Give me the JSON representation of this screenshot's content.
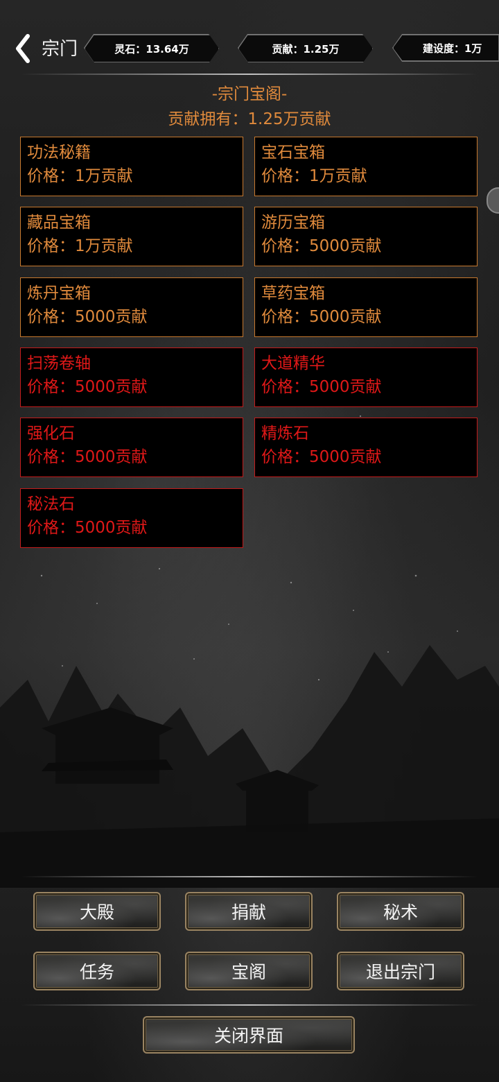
{
  "header": {
    "title": "宗门",
    "stats": [
      {
        "label": "灵石：13.64万"
      },
      {
        "label": "贡献：1.25万"
      },
      {
        "label": "建设度：1万"
      }
    ]
  },
  "shop": {
    "title": "-宗门宝阁-",
    "owned": "贡献拥有：1.25万贡献",
    "items": [
      {
        "name": "功法秘籍",
        "price": "价格：1万贡献",
        "affordable": true
      },
      {
        "name": "宝石宝箱",
        "price": "价格：1万贡献",
        "affordable": true
      },
      {
        "name": "藏品宝箱",
        "price": "价格：1万贡献",
        "affordable": true
      },
      {
        "name": "游历宝箱",
        "price": "价格：5000贡献",
        "affordable": true
      },
      {
        "name": "炼丹宝箱",
        "price": "价格：5000贡献",
        "affordable": true
      },
      {
        "name": "草药宝箱",
        "price": "价格：5000贡献",
        "affordable": true
      },
      {
        "name": "扫荡卷轴",
        "price": "价格：5000贡献",
        "affordable": false
      },
      {
        "name": "大道精华",
        "price": "价格：5000贡献",
        "affordable": false
      },
      {
        "name": "强化石",
        "price": "价格：5000贡献",
        "affordable": false
      },
      {
        "name": "精炼石",
        "price": "价格：5000贡献",
        "affordable": false
      },
      {
        "name": "秘法石",
        "price": "价格：5000贡献",
        "affordable": false
      }
    ]
  },
  "nav": {
    "hall": "大殿",
    "donate": "捐献",
    "secret_art": "秘术",
    "tasks": "任务",
    "treasure": "宝阁",
    "leave": "退出宗门",
    "close": "关闭界面"
  },
  "colors": {
    "affordable": "#e08a3c",
    "unaffordable": "#e01818",
    "button_frame": "#9a8462"
  }
}
